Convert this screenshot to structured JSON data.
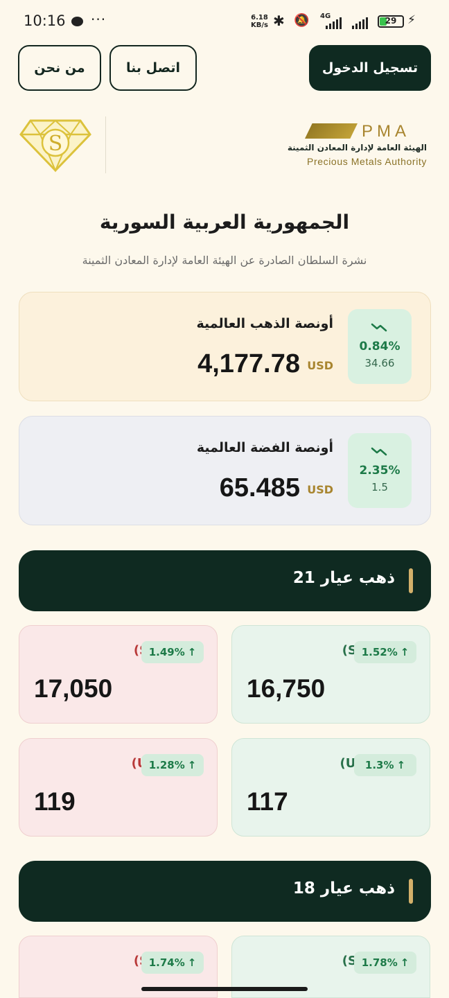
{
  "status_bar": {
    "time": "10:16",
    "dots": "···",
    "speed_value": "6.18",
    "speed_unit": "KB/s",
    "network": "4G",
    "battery": "29"
  },
  "nav": {
    "login": "تسجيل الدخول",
    "contact": "اتصل بنا",
    "about": "من نحن"
  },
  "logos": {
    "pma_letters": "PMA",
    "pma_arabic": "الهيئة العامة لإدارة المعادن الثمينة",
    "pma_english": "Precious Metals Authority",
    "s_letter": "S"
  },
  "header": {
    "title": "الجمهورية العربية السورية",
    "subtitle": "نشرة السلطان الصادرة عن الهيئة العامة لإدارة المعادن الثمينة"
  },
  "gold_ounce": {
    "label": "أونصة الذهب العالمية",
    "price": "4,177.78",
    "unit": "USD",
    "change_pct": "0.84%",
    "change_abs": "34.66"
  },
  "silver_ounce": {
    "label": "أونصة الفضة العالمية",
    "price": "65.485",
    "unit": "USD",
    "change_pct": "2.35%",
    "change_abs": "1.5"
  },
  "sections": [
    {
      "title": "ذهب عيار 21",
      "cards": [
        {
          "label": "مبيع (SYP)",
          "change": "1.49%",
          "value": "17,050",
          "type": "sell"
        },
        {
          "label": "شراء (SYP)",
          "change": "1.52%",
          "value": "16,750",
          "type": "buy"
        },
        {
          "label": "مبيع (USD)",
          "change": "1.28%",
          "value": "119",
          "type": "sell"
        },
        {
          "label": "شراء (USD)",
          "change": "1.3%",
          "value": "117",
          "type": "buy"
        }
      ]
    },
    {
      "title": "ذهب عيار 18",
      "cards": [
        {
          "label": "مبيع (SYP)",
          "change": "1.74%",
          "value": "",
          "type": "sell"
        },
        {
          "label": "شراء (SYP)",
          "change": "1.78%",
          "value": "",
          "type": "buy"
        }
      ]
    }
  ],
  "colors": {
    "background": "#fdf8ec",
    "primary_dark": "#0f2a21",
    "gold_accent": "#a8852f",
    "up_green": "#1d7a48",
    "sell_red": "#b83a3a"
  },
  "icons": [
    "chat-icon",
    "bluetooth-icon",
    "mute-icon",
    "signal-icon",
    "battery-icon",
    "trend-up-icon",
    "arrow-up-icon"
  ]
}
